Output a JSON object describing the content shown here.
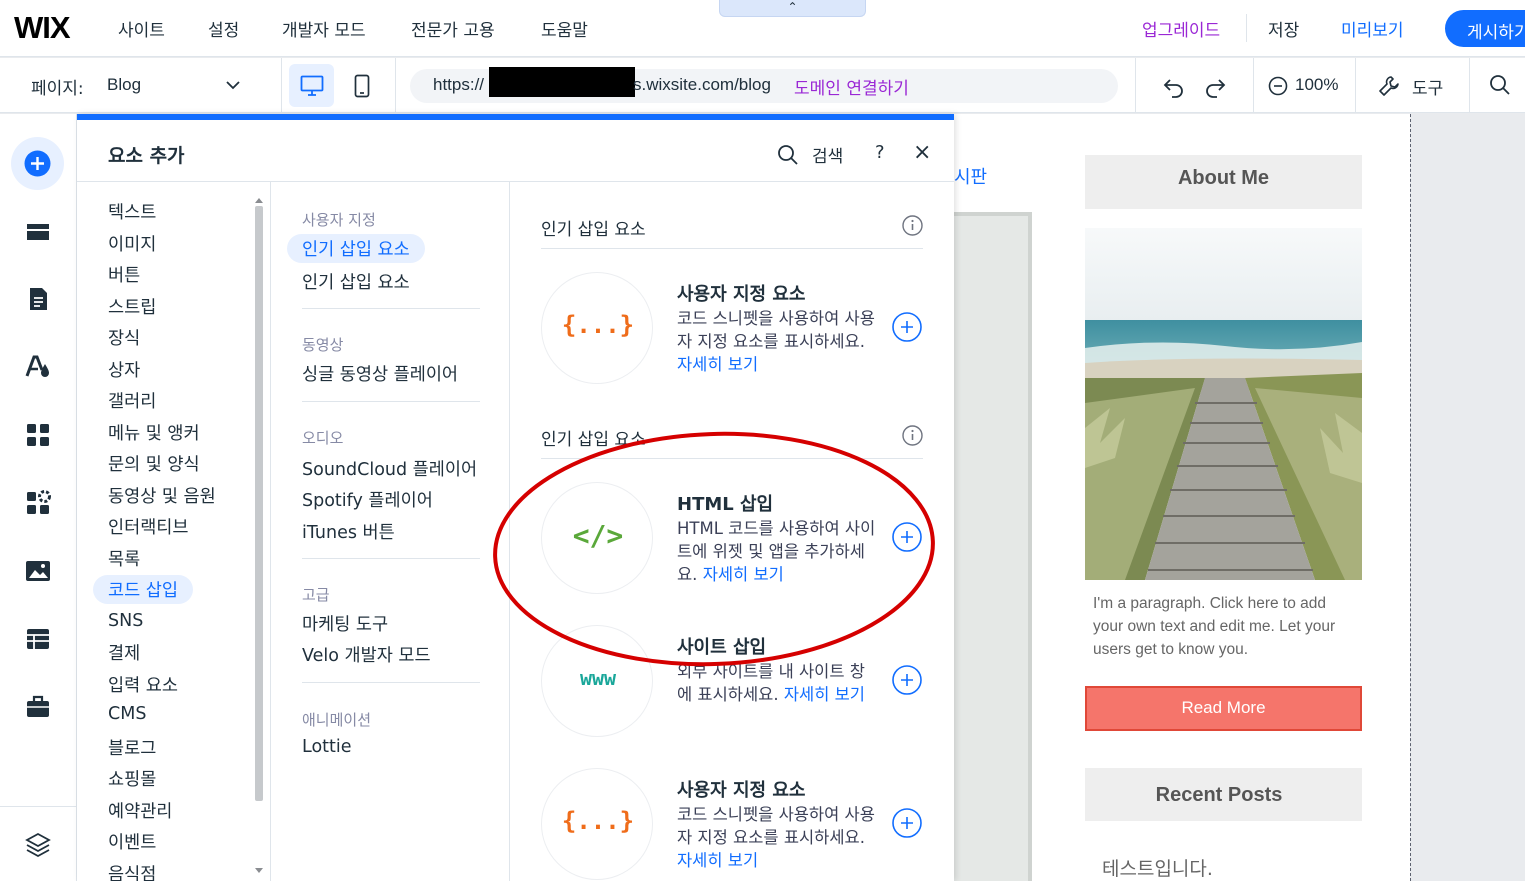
{
  "topbar": {
    "logo": "WIX",
    "nav": [
      "사이트",
      "설정",
      "개발자 모드",
      "전문가 고용",
      "도움말"
    ],
    "collapse": "⌃",
    "upgrade": "업그레이드",
    "save": "저장",
    "preview": "미리보기",
    "publish": "게시하기"
  },
  "toolbar": {
    "page_label": "페이지:",
    "page_value": "Blog",
    "url_prefix": "https://",
    "url_suffix": "s.wixsite.com/blog",
    "connect_domain": "도메인 연결하기",
    "zoom": "100%",
    "tools": "도구"
  },
  "panel": {
    "title": "요소 추가",
    "search": "검색",
    "help": "?",
    "close": "×",
    "categories": [
      "텍스트",
      "이미지",
      "버튼",
      "스트립",
      "장식",
      "상자",
      "갤러리",
      "메뉴 및 앵커",
      "문의 및 양식",
      "동영상 및 음원",
      "인터랙티브",
      "목록",
      "코드 삽입",
      "SNS",
      "결제",
      "입력 요소",
      "CMS",
      "블로그",
      "쇼핑몰",
      "예약관리",
      "이벤트",
      "음식점"
    ],
    "selected_category": "코드 삽입",
    "sub_groups": [
      {
        "heading": "사용자 지정",
        "items": [
          "인기 삽입 요소",
          "인기 삽입 요소"
        ]
      },
      {
        "heading": "동영상",
        "items": [
          "싱글 동영상 플레이어"
        ]
      },
      {
        "heading": "오디오",
        "items": [
          "SoundCloud 플레이어",
          "Spotify 플레이어",
          "iTunes 버튼"
        ]
      },
      {
        "heading": "고급",
        "items": [
          "마케팅 도구",
          "Velo 개발자 모드"
        ]
      },
      {
        "heading": "애니메이션",
        "items": [
          "Lottie"
        ]
      }
    ],
    "sections": [
      {
        "title": "인기 삽입 요소"
      },
      {
        "title": "인기 삽입 요소"
      }
    ],
    "items": [
      {
        "icon": "{...}",
        "title": "사용자 지정 요소",
        "desc": "코드 스니펫을 사용하여 사용자 지정 요소를 표시하세요.",
        "link": "자세히 보기",
        "color": "#ef6c1a"
      },
      {
        "icon": "</>",
        "title": "HTML 삽입",
        "desc": "HTML 코드를 사용하여 사이트에 위젯 및 앱을 추가하세요.",
        "link": "자세히 보기",
        "color": "#5aa83a"
      },
      {
        "icon": "www",
        "title": "사이트 삽입",
        "desc": "외부 사이트를 내 사이트 창에 표시하세요.",
        "link": "자세히 보기",
        "color": "#1aa79a"
      },
      {
        "icon": "{...}",
        "title": "사용자 지정 요소",
        "desc": "코드 스니펫을 사용하여 사용자 지정 요소를 표시하세요.",
        "link": "자세히 보기",
        "color": "#ef6c1a"
      }
    ]
  },
  "canvas": {
    "board_fragment": "시판",
    "about_title": "About Me",
    "about_paragraph": "I'm a paragraph. Click here to add your own text and edit me. Let your users get to know you.",
    "read_more": "Read More",
    "recent_title": "Recent Posts",
    "recent_post": "테스트입니다."
  },
  "colors": {
    "accent": "#116dff",
    "upgrade": "#9a27d5",
    "highlight_ring": "#d50000"
  }
}
